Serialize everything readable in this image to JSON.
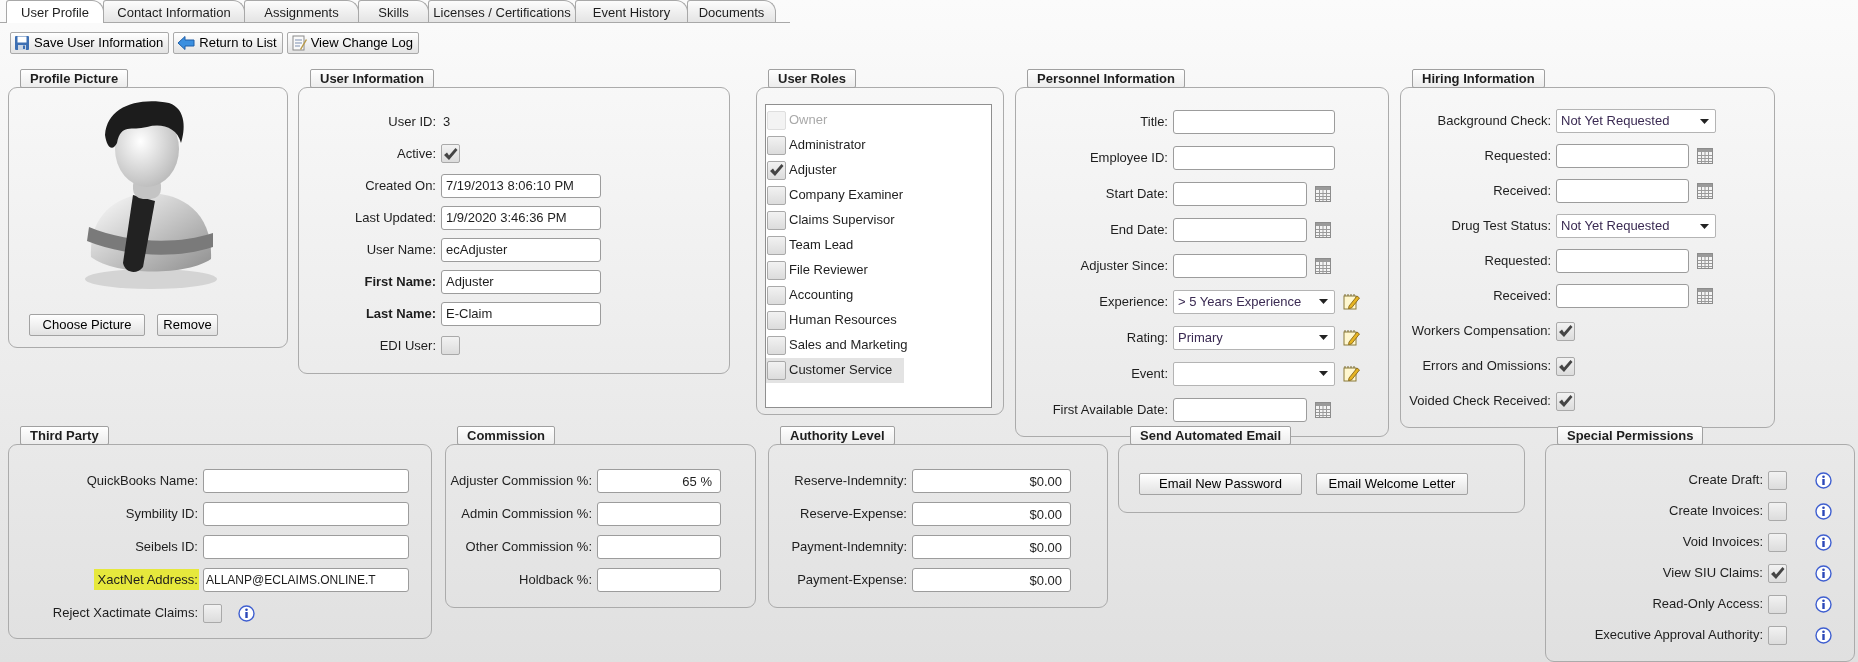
{
  "tabs": [
    {
      "label": "User Profile",
      "selected": true
    },
    {
      "label": "Contact Information",
      "selected": false
    },
    {
      "label": "Assignments",
      "selected": false
    },
    {
      "label": "Skills",
      "selected": false
    },
    {
      "label": "Licenses / Certifications",
      "selected": false
    },
    {
      "label": "Event History",
      "selected": false
    },
    {
      "label": "Documents",
      "selected": false
    }
  ],
  "toolbar": [
    "Save User Information",
    "Return to List",
    "View Change Log"
  ],
  "profile_picture": {
    "title": "Profile Picture",
    "buttons": [
      "Choose Picture",
      "Remove"
    ]
  },
  "user_information": {
    "title": "User Information",
    "fields": [
      {
        "label": "User ID:",
        "kind": "static",
        "value": "3",
        "bold": false
      },
      {
        "label": "Active:",
        "kind": "checkbox",
        "checked": true,
        "bold": false
      },
      {
        "label": "Created On:",
        "kind": "input",
        "value": "7/19/2013 8:06:10 PM",
        "bold": false
      },
      {
        "label": "Last Updated:",
        "kind": "input",
        "value": "1/9/2020 3:46:36 PM",
        "bold": false
      },
      {
        "label": "User Name:",
        "kind": "input",
        "value": "ecAdjuster",
        "bold": false
      },
      {
        "label": "First Name:",
        "kind": "input",
        "value": "Adjuster",
        "bold": true
      },
      {
        "label": "Last Name:",
        "kind": "input",
        "value": "E-Claim",
        "bold": true
      },
      {
        "label": "EDI User:",
        "kind": "checkbox",
        "checked": false,
        "bold": false
      }
    ]
  },
  "user_roles": {
    "title": "User Roles",
    "items": [
      {
        "label": "Owner",
        "checked": false,
        "disabled": true,
        "selected": false
      },
      {
        "label": "Administrator",
        "checked": false,
        "disabled": false,
        "selected": false
      },
      {
        "label": "Adjuster",
        "checked": true,
        "disabled": false,
        "selected": false
      },
      {
        "label": "Company Examiner",
        "checked": false,
        "disabled": false,
        "selected": false
      },
      {
        "label": "Claims Supervisor",
        "checked": false,
        "disabled": false,
        "selected": false
      },
      {
        "label": "Team Lead",
        "checked": false,
        "disabled": false,
        "selected": false
      },
      {
        "label": "File Reviewer",
        "checked": false,
        "disabled": false,
        "selected": false
      },
      {
        "label": "Accounting",
        "checked": false,
        "disabled": false,
        "selected": false
      },
      {
        "label": "Human Resources",
        "checked": false,
        "disabled": false,
        "selected": false
      },
      {
        "label": "Sales and Marketing",
        "checked": false,
        "disabled": false,
        "selected": false
      },
      {
        "label": "Customer Service",
        "checked": false,
        "disabled": false,
        "selected": true
      }
    ]
  },
  "personnel_information": {
    "title": "Personnel Information",
    "fields": [
      {
        "label": "Title:",
        "kind": "input"
      },
      {
        "label": "Employee ID:",
        "kind": "input"
      },
      {
        "label": "Start Date:",
        "kind": "date"
      },
      {
        "label": "End Date:",
        "kind": "date"
      },
      {
        "label": "Adjuster Since:",
        "kind": "date"
      },
      {
        "label": "Experience:",
        "kind": "select_edit",
        "value": "> 5 Years Experience"
      },
      {
        "label": "Rating:",
        "kind": "select_edit",
        "value": "Primary"
      },
      {
        "label": "Event:",
        "kind": "select_edit"
      },
      {
        "label": "First Available Date:",
        "kind": "date"
      }
    ]
  },
  "hiring_information": {
    "title": "Hiring Information",
    "fields": [
      {
        "label": "Background Check:",
        "kind": "select",
        "value": "Not Yet Requested"
      },
      {
        "label": "Requested:",
        "kind": "date"
      },
      {
        "label": "Received:",
        "kind": "date"
      },
      {
        "label": "Drug Test Status:",
        "kind": "select",
        "value": "Not Yet Requested"
      },
      {
        "label": "Requested:",
        "kind": "date"
      },
      {
        "label": "Received:",
        "kind": "date"
      },
      {
        "label": "Workers Compensation:",
        "kind": "checkbox",
        "checked": true
      },
      {
        "label": "Errors and Omissions:",
        "kind": "checkbox",
        "checked": true
      },
      {
        "label": "Voided Check Received:",
        "kind": "checkbox",
        "checked": true
      }
    ]
  },
  "third_party": {
    "title": "Third Party",
    "fields": [
      {
        "label": "QuickBooks Name:",
        "kind": "input",
        "highlighted": false
      },
      {
        "label": "Symbility ID:",
        "kind": "input",
        "highlighted": false
      },
      {
        "label": "Seibels ID:",
        "kind": "input",
        "highlighted": false
      },
      {
        "label": "XactNet Address:",
        "kind": "input",
        "value": "ALLANP@ECLAIMS.ONLINE.T",
        "highlighted": true
      },
      {
        "label": "Reject Xactimate Claims:",
        "kind": "checkbox",
        "checked": false,
        "info": true,
        "highlighted": false
      }
    ]
  },
  "commission": {
    "title": "Commission",
    "fields": [
      {
        "label": "Adjuster Commission %:",
        "kind": "amount",
        "value": "65 %"
      },
      {
        "label": "Admin Commission %:",
        "kind": "amount"
      },
      {
        "label": "Other Commission %:",
        "kind": "amount"
      },
      {
        "label": "Holdback %:",
        "kind": "amount"
      }
    ]
  },
  "authority_level": {
    "title": "Authority Level",
    "fields": [
      {
        "label": "Reserve-Indemnity:",
        "kind": "amount",
        "value": "$0.00"
      },
      {
        "label": "Reserve-Expense:",
        "kind": "amount",
        "value": "$0.00"
      },
      {
        "label": "Payment-Indemnity:",
        "kind": "amount",
        "value": "$0.00"
      },
      {
        "label": "Payment-Expense:",
        "kind": "amount",
        "value": "$0.00"
      }
    ]
  },
  "send_automated_email": {
    "title": "Send Automated Email",
    "buttons": [
      "Email New Password",
      "Email Welcome Letter"
    ]
  },
  "special_permissions": {
    "title": "Special Permissions",
    "fields": [
      {
        "label": "Create Draft:",
        "kind": "checkbox",
        "checked": false,
        "info": true
      },
      {
        "label": "Create Invoices:",
        "kind": "checkbox",
        "checked": false,
        "info": true
      },
      {
        "label": "Void Invoices:",
        "kind": "checkbox",
        "checked": false,
        "info": true
      },
      {
        "label": "View SIU Claims:",
        "kind": "checkbox",
        "checked": true,
        "info": true
      },
      {
        "label": "Read-Only Access:",
        "kind": "checkbox",
        "checked": false,
        "info": true
      },
      {
        "label": "Executive Approval Authority:",
        "kind": "checkbox",
        "checked": false,
        "info": true
      }
    ]
  }
}
